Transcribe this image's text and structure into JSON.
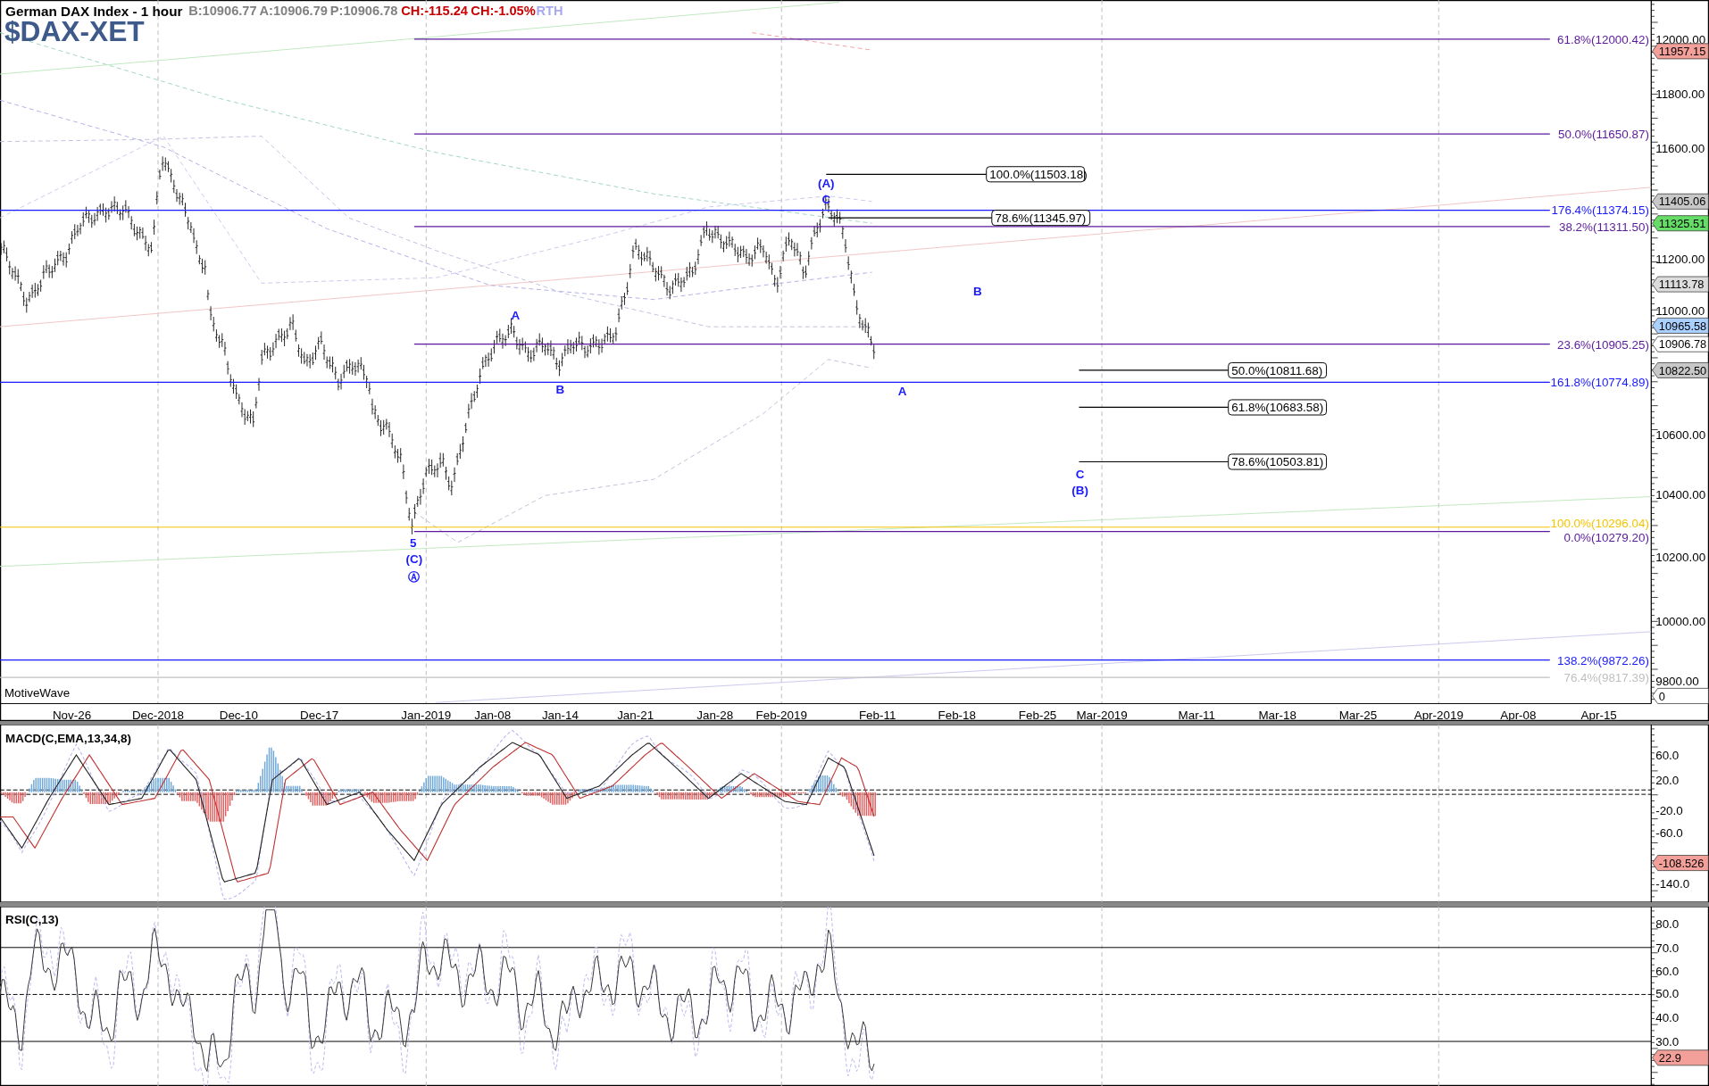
{
  "header": {
    "title": "German DAX Index - 1 hour",
    "symbol": "$DAX-XET",
    "quotes": [
      {
        "text": "B:10906.77",
        "kind": "quote"
      },
      {
        "text": "A:10906.79",
        "kind": "quote"
      },
      {
        "text": "P:10906.78",
        "kind": "quote"
      },
      {
        "text": "CH:-115.24",
        "kind": "change"
      },
      {
        "text": "CH:-1.05%",
        "kind": "change"
      },
      {
        "text": "RTH",
        "kind": "session"
      }
    ]
  },
  "price_chart": {
    "platform_label": "MotiveWave",
    "fib_levels": [
      {
        "label": "61.8%(12000.42)",
        "kind": "level",
        "color": "#5a1a9a"
      },
      {
        "label": "50.0%(11650.87)",
        "kind": "level",
        "color": "#5a1a9a"
      },
      {
        "label": "100.0%(11503.18)",
        "kind": "projection",
        "color": "#000000"
      },
      {
        "label": "176.4%(11374.15)",
        "kind": "level",
        "color": "#1a1aff"
      },
      {
        "label": "78.6%(11345.97)",
        "kind": "projection",
        "color": "#000000"
      },
      {
        "label": "38.2%(11311.50)",
        "kind": "level",
        "color": "#5a1a9a"
      },
      {
        "label": "23.6%(10905.25)",
        "kind": "level",
        "color": "#5a1a9a"
      },
      {
        "label": "50.0%(10811.68)",
        "kind": "projection",
        "color": "#000000"
      },
      {
        "label": "161.8%(10774.89)",
        "kind": "level",
        "color": "#1a1aff"
      },
      {
        "label": "61.8%(10683.58)",
        "kind": "projection",
        "color": "#000000"
      },
      {
        "label": "78.6%(10503.81)",
        "kind": "projection",
        "color": "#000000"
      },
      {
        "label": "100.0%(10296.04)",
        "kind": "level",
        "color": "#f5c400"
      },
      {
        "label": "0.0%(10279.20)",
        "kind": "level",
        "color": "#5a1a9a"
      },
      {
        "label": "138.2%(9872.26)",
        "kind": "level",
        "color": "#1a1aff"
      },
      {
        "label": "76.4%(9817.39)",
        "kind": "level",
        "color": "#c0c0c0"
      }
    ],
    "wave_labels": [
      "(A)",
      "C",
      "B",
      "A",
      "B",
      "A",
      "C",
      "(B)",
      "5",
      "(C)",
      "Ⓐ"
    ],
    "price_ticks": [
      "12000.00",
      "11800.00",
      "11600.00",
      "11200.00",
      "11000.00",
      "10600.00",
      "10400.00",
      "10200.00",
      "10000.00",
      "9800.00"
    ],
    "price_tags": [
      {
        "text": "11957.15",
        "color": "#f4a09a"
      },
      {
        "text": "11405.06",
        "color": "#c8c8c8"
      },
      {
        "text": "11325.51",
        "color": "#66dd66"
      },
      {
        "text": "11113.78",
        "color": "#dcdcdc"
      },
      {
        "text": "10965.58",
        "color": "#aad0ff"
      },
      {
        "text": "10906.78",
        "color": "#ffffff"
      },
      {
        "text": "10822.50",
        "color": "#c8c8c8"
      },
      {
        "text": "0",
        "color": "#ffffff"
      }
    ],
    "dates": [
      "Nov-26",
      "Dec-2018",
      "Dec-10",
      "Dec-17",
      "Jan-2019",
      "Jan-08",
      "Jan-14",
      "Jan-21",
      "Jan-28",
      "Feb-2019",
      "Feb-11",
      "Feb-18",
      "Feb-25",
      "Mar-2019",
      "Mar-11",
      "Mar-18",
      "Mar-25",
      "Apr-2019",
      "Apr-08",
      "Apr-15"
    ]
  },
  "macd": {
    "title": "MACD(C,EMA,13,34,8)",
    "ticks": [
      "60.0",
      "20.0",
      "-20.0",
      "-60.0",
      "-140.0"
    ],
    "tags": [
      {
        "text": "-108.526",
        "color": "#f4a09a"
      }
    ]
  },
  "rsi": {
    "title": "RSI(C,13)",
    "ticks": [
      "80.0",
      "70.0",
      "60.0",
      "50.0",
      "40.0",
      "30.0"
    ],
    "tags": [
      {
        "text": "22.9",
        "color": "#f4a09a"
      }
    ]
  }
}
